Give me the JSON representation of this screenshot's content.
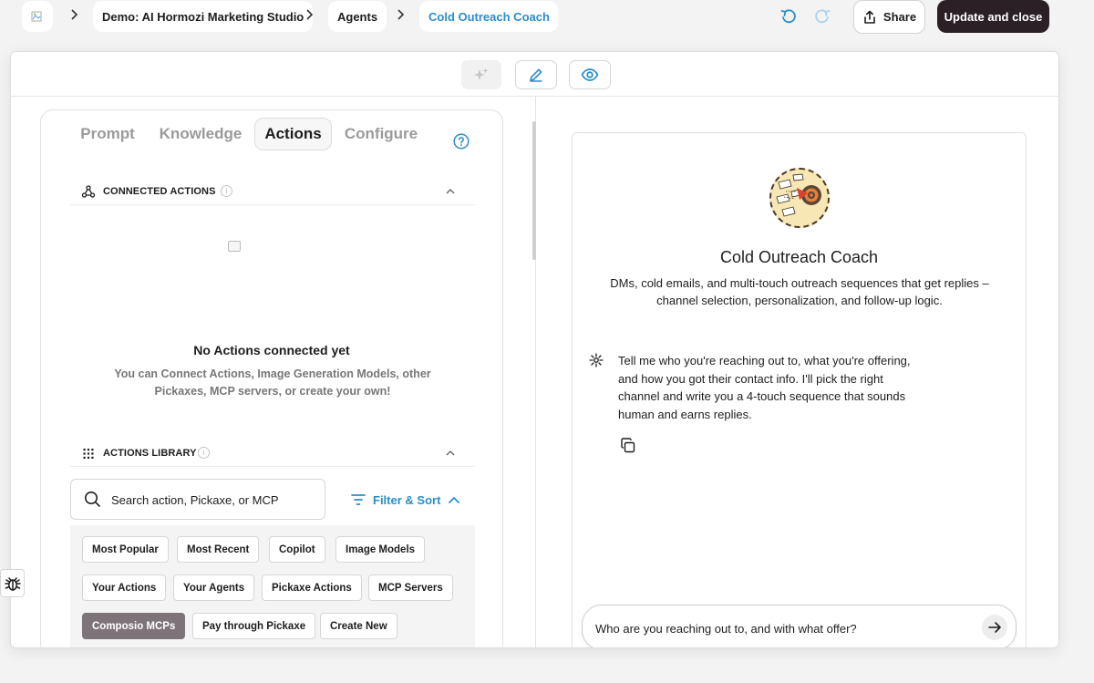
{
  "topbar": {
    "logo_icon": "broken-image-icon",
    "breadcrumbs": [
      {
        "label": "Demo: AI Hormozi Marketing Studio"
      },
      {
        "label": "Agents"
      },
      {
        "label": "Cold Outreach Coach"
      }
    ],
    "share_label": "Share",
    "update_label": "Update and close"
  },
  "toolbar": {
    "icons": [
      "sparkle-icon",
      "pencil-icon",
      "eye-icon"
    ]
  },
  "left": {
    "tabs": [
      {
        "label": "Prompt"
      },
      {
        "label": "Knowledge"
      },
      {
        "label": "Actions"
      },
      {
        "label": "Configure"
      }
    ],
    "active_tab": "Actions",
    "connected": {
      "title": "CONNECTED ACTIONS",
      "empty_title": "No Actions connected yet",
      "empty_sub": "You can Connect Actions, Image Generation Models, other Pickaxes, MCP servers, or create your own!"
    },
    "library": {
      "title": "ACTIONS LIBRARY",
      "search_placeholder": "Search action, Pickaxe, or MCP",
      "filter_label": "Filter & Sort",
      "chips": [
        {
          "label": "Most Popular"
        },
        {
          "label": "Most Recent"
        },
        {
          "label": "Copilot"
        },
        {
          "label": "Image Models"
        },
        {
          "label": "Your Actions"
        },
        {
          "label": "Your Agents"
        },
        {
          "label": "Pickaxe Actions"
        },
        {
          "label": "MCP Servers"
        },
        {
          "label": "Composio MCPs"
        },
        {
          "label": "Pay through Pickaxe"
        },
        {
          "label": "Create New"
        }
      ],
      "selected_chip": "Composio MCPs"
    }
  },
  "preview": {
    "agent_name": "Cold Outreach Coach",
    "agent_description": "DMs, cold emails, and multi-touch outreach sequences that get replies – channel selection, personalization, and follow-up logic.",
    "bot_message": "Tell me who you're reaching out to, what you're offering, and how you got their contact info. I'll pick the right channel and write you a 4-touch sequence that sounds human and earns replies.",
    "input_placeholder": "Who are you reaching out to, and with what offer?"
  },
  "colors": {
    "accent_blue": "#2a8dcb",
    "dark_button": "#2a2025",
    "selected_chip": "#7d7479"
  }
}
